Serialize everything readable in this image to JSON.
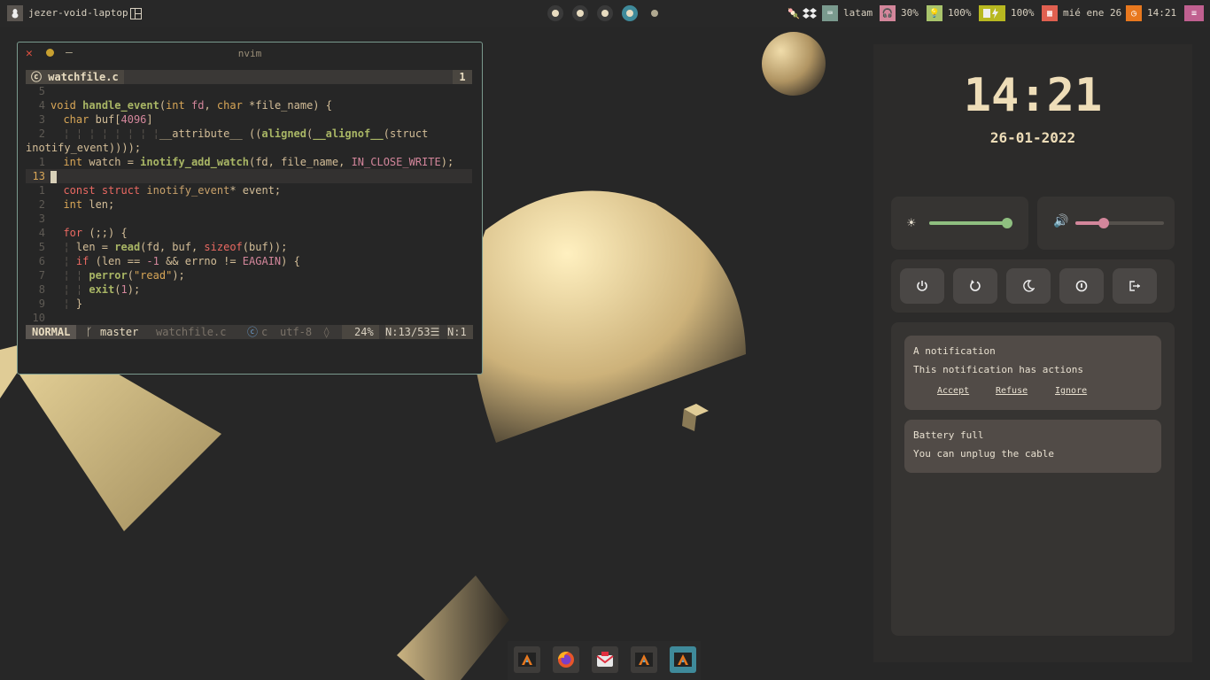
{
  "topbar": {
    "hostname": "jezer-void-laptop",
    "keyboard_layout": "latam",
    "headphones_level": "30%",
    "brightness_level": "100%",
    "battery_level": "100%",
    "date": "mié ene 26",
    "time": "14:21",
    "workspaces": [
      "1",
      "2",
      "3",
      "4",
      "5"
    ],
    "active_workspace": 4,
    "colors": {
      "kbd": "#7a9a8e",
      "headphones": "#d3869b",
      "brightness": "#a9c46c",
      "battery": "#b8b820",
      "calendar": "#e06050",
      "clock": "#e8781e",
      "menu": "#c06090"
    }
  },
  "nvim": {
    "window_title": "nvim",
    "tab_label": "watchfile.c",
    "tab_number": "1",
    "lines": [
      {
        "n": "5",
        "t": ""
      },
      {
        "n": "4",
        "t": "void handle_event(int fd, char *file_name) {"
      },
      {
        "n": "3",
        "t": "  char buf[4096]"
      },
      {
        "n": "2",
        "t": "  ¦ ¦ ¦ ¦ ¦ ¦ ¦ ¦__attribute__ ((aligned(__alignof__(struct"
      },
      {
        "n": "",
        "t": "inotify_event))));"
      },
      {
        "n": "1",
        "t": "  int watch = inotify_add_watch(fd, file_name, IN_CLOSE_WRITE);"
      },
      {
        "n": "13",
        "t": ""
      },
      {
        "n": "1",
        "t": "  const struct inotify_event* event;"
      },
      {
        "n": "2",
        "t": "  int len;"
      },
      {
        "n": "3",
        "t": ""
      },
      {
        "n": "4",
        "t": "  for (;;) {"
      },
      {
        "n": "5",
        "t": "  ¦ len = read(fd, buf, sizeof(buf));"
      },
      {
        "n": "6",
        "t": "  ¦ if (len == -1 && errno != EAGAIN) {"
      },
      {
        "n": "7",
        "t": "  ¦ ¦ perror(\"read\");"
      },
      {
        "n": "8",
        "t": "  ¦ ¦ exit(1);"
      },
      {
        "n": "9",
        "t": "  ¦ }"
      },
      {
        "n": "10",
        "t": ""
      }
    ],
    "status": {
      "mode": "NORMAL",
      "branch": "master",
      "filename": "watchfile.c",
      "filetype": "c",
      "encoding": "utf-8",
      "percent": "24%",
      "position": "N:13/53☰",
      "column": "N:1"
    }
  },
  "panel": {
    "clock": "14:21",
    "date": "26-01-2022",
    "brightness": 0.94,
    "volume": 0.32,
    "colors": {
      "brightness": "#8fbf80",
      "volume": "#d3869b"
    },
    "notifications": [
      {
        "title": "A notification",
        "body": "This notification has actions",
        "actions": [
          "Accept",
          "Refuse",
          "Ignore"
        ]
      },
      {
        "title": "Battery full",
        "body": "You can unplug the cable"
      }
    ]
  },
  "dock": {
    "apps": [
      "alacritty-icon",
      "firefox-icon",
      "mail-icon",
      "alacritty-icon",
      "alacritty-icon"
    ],
    "active_index": 4
  }
}
